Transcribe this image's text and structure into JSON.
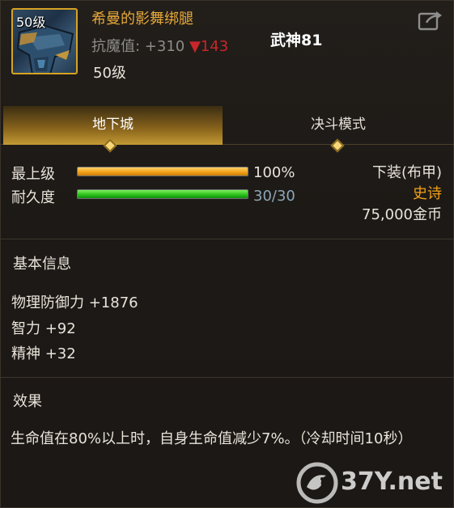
{
  "item": {
    "level_badge": "50级",
    "name": "希曼的影舞绑腿",
    "resist_label": "抗魔值: +310",
    "resist_delta": "▼143",
    "title": "武神81",
    "level": "50级"
  },
  "tabs": [
    {
      "label": "地下城",
      "active": true
    },
    {
      "label": "决斗模式",
      "active": false
    }
  ],
  "stats": {
    "upgrade_label": "最上级",
    "upgrade_percent": 100,
    "upgrade_value": "100%",
    "durability_label": "耐久度",
    "durability_current": 30,
    "durability_max": 30,
    "durability_value": "30/30"
  },
  "info": {
    "slot": "下装(布甲)",
    "rarity": "史诗",
    "price": "75,000金币"
  },
  "basic": {
    "title": "基本信息",
    "lines": [
      "物理防御力 +1876",
      "智力 +92",
      "精神 +32"
    ]
  },
  "effect": {
    "title": "效果",
    "text": "生命值在80%以上时，自身生命值减少7%。（冷却时间10秒）"
  },
  "watermark": "37Y.net",
  "icons": {
    "share": "share-export-icon",
    "tab_marker": "diamond-marker-icon",
    "watermark_logo": "bird-logo-icon"
  },
  "colors": {
    "gold": "#e6a83a",
    "rarity": "#f2a118",
    "down": "#c8262b",
    "durability": "#8da6b8"
  }
}
